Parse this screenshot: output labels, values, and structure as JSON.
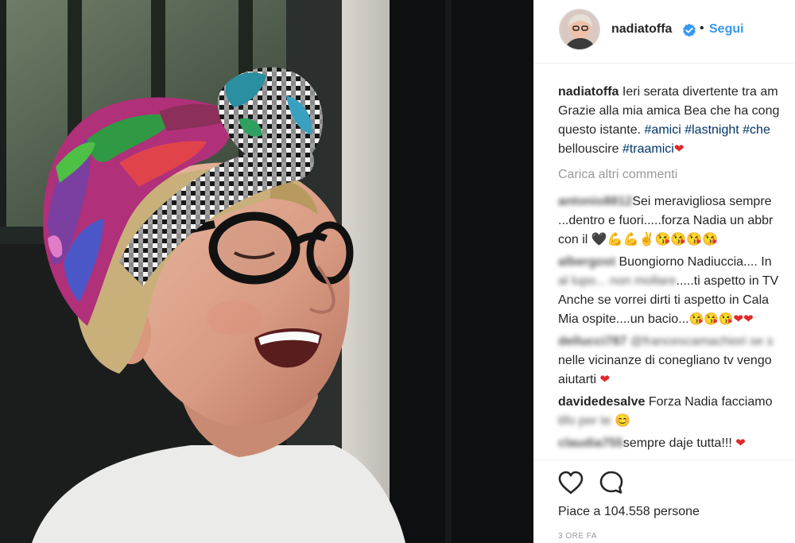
{
  "post": {
    "author": "nadiatoffa",
    "follow_label": "Segui",
    "separator": "•",
    "icons": {
      "verified": "verified-badge-icon",
      "like": "heart-outline-icon",
      "comment": "speech-bubble-icon"
    },
    "accent_color": "#3897f0",
    "hashtag_color": "#003569"
  },
  "caption": {
    "username": "nadiatoffa",
    "line1": "Ieri serata divertente tra am",
    "line2": "Grazie alla mia amica Bea che ha cong",
    "line3_text": "questo istante.",
    "line3_tags": "#amici #lastnight #che",
    "line4_text": "bellouscire",
    "line4_tag": "#traamici",
    "line4_emoji": "❤"
  },
  "load_more": "Carica altri commenti",
  "comments": [
    {
      "user": "antonio8812",
      "line1": "Sei meravigliosa sempre",
      "line2": "...dentro e fuori.....forza Nadia un abbr",
      "line3": "con il",
      "line3_emoji": "🖤💪💪✌😘😘😘😘"
    },
    {
      "user": "albergost",
      "line1": "Buongiorno Nadiuccia.... In",
      "line2_blur": "al lupo... non mollare",
      "line2": ".....ti aspetto in TV",
      "line3": "Anche se vorrei dirti ti aspetto in Cala",
      "line4": "Mia ospite....un bacio...",
      "line4_emoji": "😘😘😘❤❤"
    },
    {
      "user": "dellucci787",
      "line1_blur": "@francescamachiori se s",
      "line2": "nelle vicinanze di conegliano tv vengo",
      "line3": "aiutarti",
      "line3_emoji": "❤"
    },
    {
      "user": "davidedesalve",
      "line1": "Forza Nadia facciamo",
      "line2_blur": "tifo per te",
      "line2_emoji": "😊"
    },
    {
      "user": "claudia755",
      "line1": "sempre daje tutta!!!",
      "line1_emoji": "❤"
    }
  ],
  "likes_text": "Piace a 104.558 persone",
  "timestamp": "3 ORE FA"
}
